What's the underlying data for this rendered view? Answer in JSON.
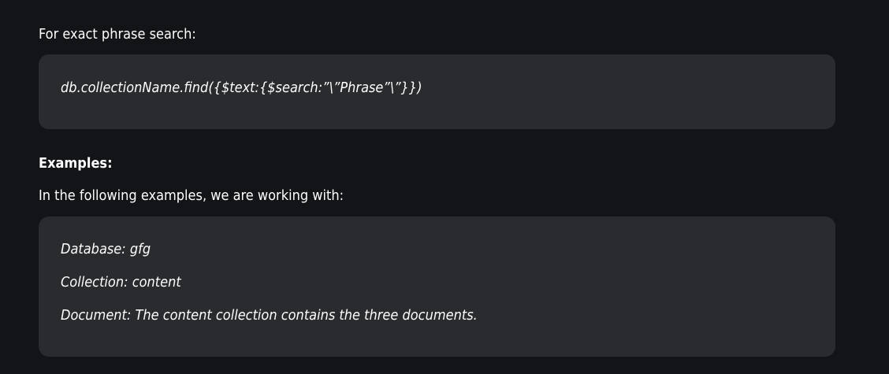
{
  "exact_phrase": {
    "label": "For exact phrase search:",
    "code": "db.collectionName.find({$text:{$search:”\\”Phrase”\\”}})"
  },
  "examples": {
    "heading": "Examples:",
    "intro": "In the following examples, we are working with:",
    "lines": [
      "Database: gfg",
      "Collection: content",
      "Document: The content collection contains the three documents."
    ]
  }
}
